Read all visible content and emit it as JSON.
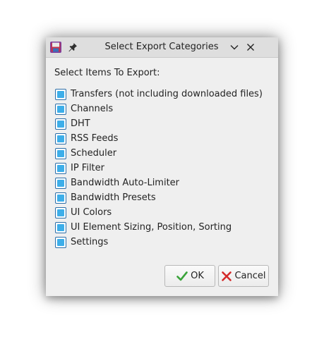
{
  "window": {
    "title": "Select Export Categories",
    "app_icon": "floppy-disk-icon",
    "pin_icon": "pin-icon",
    "minimize_icon": "chevron-down-icon",
    "close_icon": "close-icon"
  },
  "prompt": "Select Items To Export:",
  "items": [
    {
      "label": "Transfers (not including downloaded files)",
      "checked": true
    },
    {
      "label": "Channels",
      "checked": true
    },
    {
      "label": "DHT",
      "checked": true
    },
    {
      "label": "RSS Feeds",
      "checked": true
    },
    {
      "label": "Scheduler",
      "checked": true
    },
    {
      "label": "IP Filter",
      "checked": true
    },
    {
      "label": "Bandwidth Auto-Limiter",
      "checked": true
    },
    {
      "label": "Bandwidth Presets",
      "checked": true
    },
    {
      "label": "UI Colors",
      "checked": true
    },
    {
      "label": "UI Element Sizing, Position, Sorting",
      "checked": true
    },
    {
      "label": "Settings",
      "checked": true
    }
  ],
  "buttons": {
    "ok_label": "OK",
    "ok_icon": "checkmark-icon",
    "cancel_label": "Cancel",
    "cancel_icon": "x-icon"
  },
  "colors": {
    "accent": "#3daee9",
    "ok_icon": "#3aa33a",
    "cancel_icon": "#d42a2a"
  }
}
